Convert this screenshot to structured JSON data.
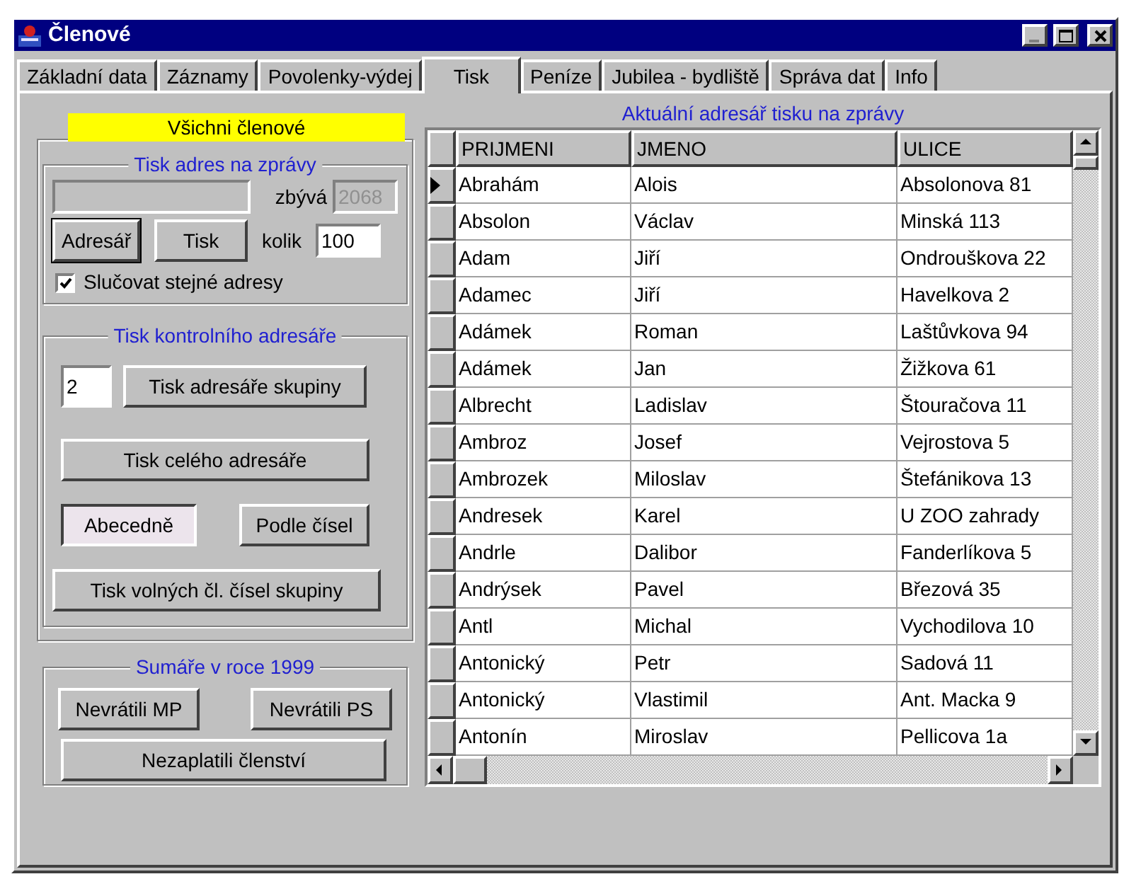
{
  "window": {
    "title": "Členové"
  },
  "tabs": [
    {
      "label": "Základní data",
      "selected": false
    },
    {
      "label": "Záznamy",
      "selected": false
    },
    {
      "label": "Povolenky-výdej",
      "selected": false
    },
    {
      "label": "Tisk",
      "selected": true
    },
    {
      "label": "Peníze",
      "selected": false
    },
    {
      "label": "Jubilea - bydliště",
      "selected": false
    },
    {
      "label": "Správa dat",
      "selected": false
    },
    {
      "label": "Info",
      "selected": false
    }
  ],
  "left": {
    "banner": "Všichni členové",
    "address_print": {
      "title": "Tisk adres na  zprávy",
      "remaining_label": "zbývá",
      "remaining": "2068",
      "count_label": "kolik",
      "count": "100",
      "buttons": [
        {
          "label": "Adresář",
          "focused": true,
          "pressed": false
        },
        {
          "label": "Tisk",
          "focused": false,
          "pressed": false
        }
      ],
      "merge": {
        "label": "Slučovat stejné adresy",
        "checked": true
      }
    },
    "control_print": {
      "title": "Tisk kontrolního adresáře",
      "group": "2",
      "group_button": {
        "label": "Tisk adresáře skupiny",
        "focused": false,
        "pressed": false
      },
      "all_button": {
        "label": "Tisk celého adresáře",
        "focused": false,
        "pressed": false
      },
      "order_buttons": [
        {
          "label": "Abecedně",
          "focused": false,
          "pressed": true
        },
        {
          "label": "Podle čísel",
          "focused": false,
          "pressed": false
        }
      ],
      "free_button": {
        "label": "Tisk volných čl. čísel skupiny",
        "focused": false,
        "pressed": false
      }
    },
    "summaries": {
      "title": "Sumáře v roce  1999",
      "buttons": [
        {
          "label": "Nevrátili  MP",
          "focused": false,
          "pressed": false
        },
        {
          "label": "Nevrátili  PS",
          "focused": false,
          "pressed": false
        }
      ],
      "bottom_button": {
        "label": "Nezaplatili členství",
        "focused": false,
        "pressed": false
      }
    }
  },
  "table": {
    "title": "Aktuální adresář tisku na zprávy",
    "columns": [
      "PRIJMENI",
      "JMENO",
      "ULICE"
    ],
    "rows": [
      {
        "cells": [
          "Abrahám",
          "Alois",
          "Absolonova 81"
        ],
        "selected": true
      },
      {
        "cells": [
          "Absolon",
          "Václav",
          "Minská 113"
        ],
        "selected": false
      },
      {
        "cells": [
          "Adam",
          "Jiří",
          "Ondrouškova 22"
        ],
        "selected": false
      },
      {
        "cells": [
          "Adamec",
          "Jiří",
          "Havelkova 2"
        ],
        "selected": false
      },
      {
        "cells": [
          "Adámek",
          "Roman",
          "Laštůvkova 94"
        ],
        "selected": false
      },
      {
        "cells": [
          "Adámek",
          "Jan",
          "Žižkova 61"
        ],
        "selected": false
      },
      {
        "cells": [
          "Albrecht",
          "Ladislav",
          "Štouračova 11"
        ],
        "selected": false
      },
      {
        "cells": [
          "Ambroz",
          "Josef",
          "Vejrostova 5"
        ],
        "selected": false
      },
      {
        "cells": [
          "Ambrozek",
          "Miloslav",
          "Štefánikova 13"
        ],
        "selected": false
      },
      {
        "cells": [
          "Andresek",
          "Karel",
          "U ZOO zahrady"
        ],
        "selected": false
      },
      {
        "cells": [
          "Andrle",
          "Dalibor",
          "Fanderlíkova 5"
        ],
        "selected": false
      },
      {
        "cells": [
          "Andrýsek",
          "Pavel",
          "Březová 35"
        ],
        "selected": false
      },
      {
        "cells": [
          "Antl",
          "Michal",
          "Vychodilova 10"
        ],
        "selected": false
      },
      {
        "cells": [
          "Antonický",
          "Petr",
          "Sadová 11"
        ],
        "selected": false
      },
      {
        "cells": [
          "Antonický",
          "Vlastimil",
          "Ant. Macka 9"
        ],
        "selected": false
      },
      {
        "cells": [
          "Antonín",
          "Miroslav",
          "Pellicova 1a"
        ],
        "selected": false
      }
    ]
  }
}
